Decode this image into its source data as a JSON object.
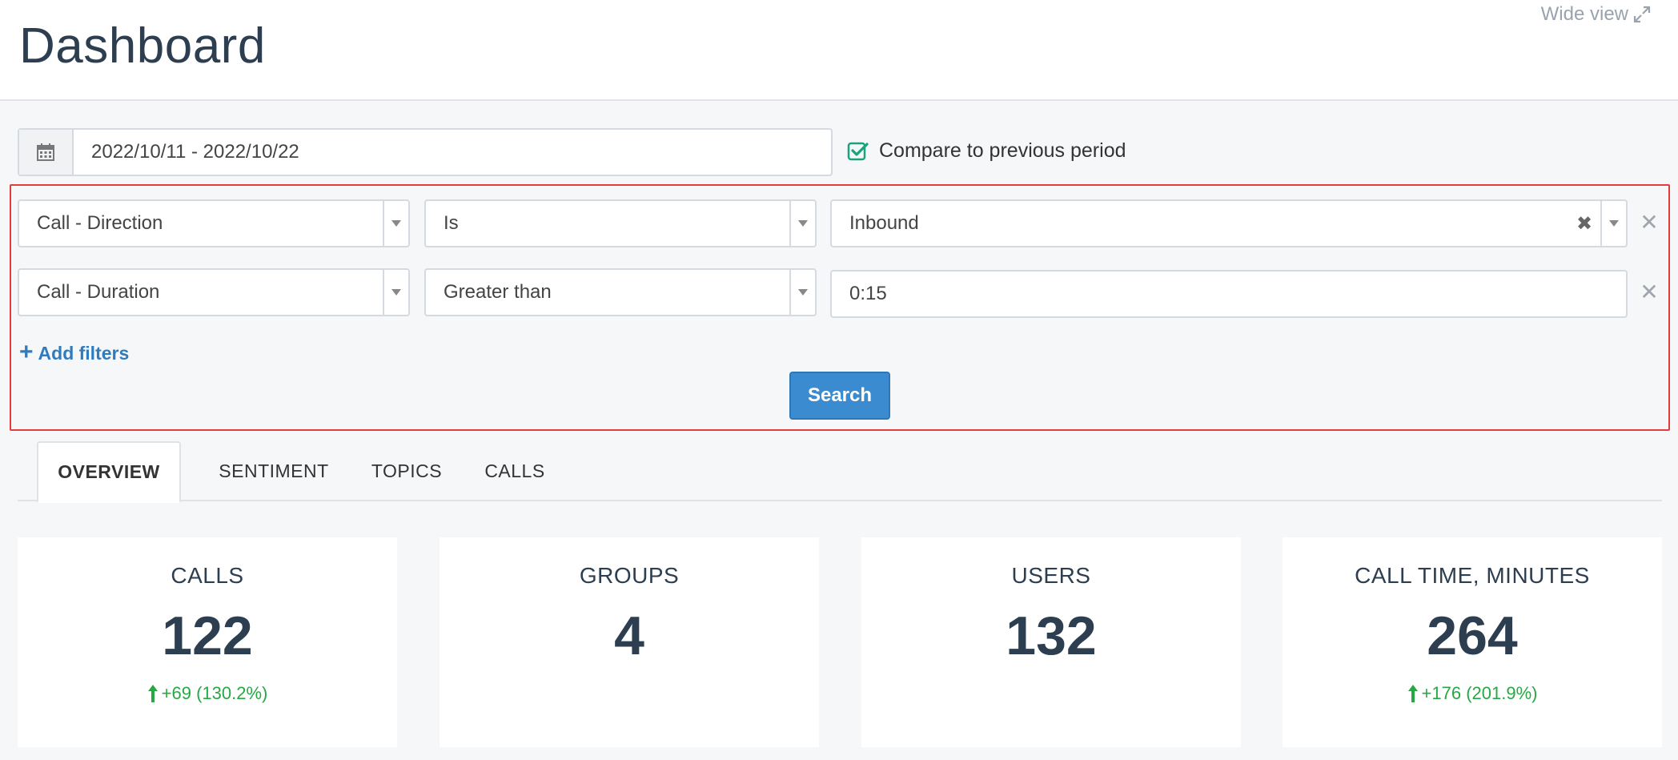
{
  "header": {
    "title": "Dashboard",
    "wide_view_label": "Wide view"
  },
  "date_range": {
    "value": "2022/10/11 - 2022/10/22",
    "compare_label": "Compare to previous period",
    "compare_checked": true
  },
  "filters": [
    {
      "field": "Call - Direction",
      "operator": "Is",
      "value": "Inbound"
    },
    {
      "field": "Call - Duration",
      "operator": "Greater than",
      "value": "0:15"
    }
  ],
  "filter_actions": {
    "add_filters_label": "Add filters",
    "search_label": "Search",
    "clear_symbol": "✖",
    "remove_symbol": "✕"
  },
  "tabs": [
    {
      "label": "OVERVIEW",
      "active": true
    },
    {
      "label": "SENTIMENT",
      "active": false
    },
    {
      "label": "TOPICS",
      "active": false
    },
    {
      "label": "CALLS",
      "active": false
    }
  ],
  "stats": [
    {
      "label": "CALLS",
      "value": "122",
      "delta": "+69 (130.2%)"
    },
    {
      "label": "GROUPS",
      "value": "4",
      "delta": ""
    },
    {
      "label": "USERS",
      "value": "132",
      "delta": ""
    },
    {
      "label": "CALL TIME, MINUTES",
      "value": "264",
      "delta": "+176 (201.9%)"
    }
  ],
  "colors": {
    "accent": "#3b8bd0",
    "link": "#2f7bbf",
    "positive": "#27a844",
    "highlight_border": "#e53b3b",
    "check": "#1aa37a"
  }
}
